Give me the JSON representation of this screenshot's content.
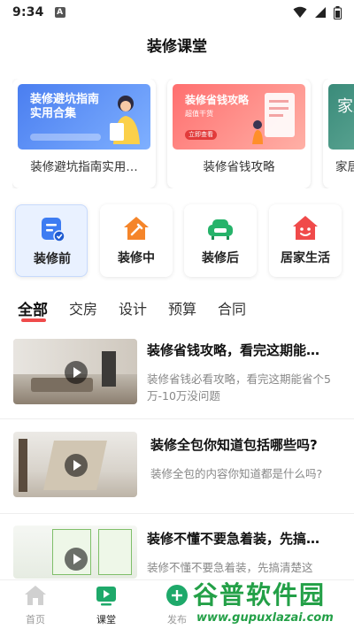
{
  "status_bar": {
    "time": "9:34",
    "notification_badge": "A"
  },
  "page_title": "装修课堂",
  "promo_cards": [
    {
      "banner_title": "装修避坑指南\n实用合集",
      "banner_sub": "",
      "caption": "装修避坑指南实用…",
      "color": "#4a7ef0"
    },
    {
      "banner_title": "装修省钱攻略",
      "banner_sub": "超值干货",
      "banner_button": "立即查看",
      "caption": "装修省钱攻略",
      "color": "#ff6f6f"
    },
    {
      "banner_title": "家居",
      "caption": "家居",
      "color": "#3a8b7a"
    }
  ],
  "categories": [
    {
      "label": "装修前",
      "icon": "notes-icon",
      "color": "#3d7cf2",
      "active": true
    },
    {
      "label": "装修中",
      "icon": "house-tool-icon",
      "color": "#f5852a"
    },
    {
      "label": "装修后",
      "icon": "sofa-icon",
      "color": "#26b36a"
    },
    {
      "label": "居家生活",
      "icon": "smiley-house-icon",
      "color": "#f04a4a"
    }
  ],
  "tabs": [
    "全部",
    "交房",
    "设计",
    "预算",
    "合同"
  ],
  "active_tab": "全部",
  "articles": [
    {
      "title": "装修省钱攻略，看完这期能…",
      "desc": "装修省钱必看攻略，看完这期能省个5万-10万没问题"
    },
    {
      "title": "装修全包你知道包括哪些吗?",
      "desc": "装修全包的内容你知道都是什么吗?"
    },
    {
      "title": "装修不懂不要急着装，先搞…",
      "desc": "装修不懂不要急着装，先搞清楚这"
    }
  ],
  "bottom_nav": [
    {
      "label": "首页",
      "icon": "home-icon"
    },
    {
      "label": "课堂",
      "icon": "play-board-icon",
      "active": true
    },
    {
      "label": "发布",
      "icon": "plus-circle-icon"
    }
  ],
  "watermark": {
    "title": "谷普软件园",
    "url": "www.gupuxlazai.com"
  },
  "colors": {
    "accent_red": "#ef4b4b",
    "active_category_bg": "#e9f1ff",
    "nav_active": "#1ea96a",
    "watermark_green": "#23a047"
  }
}
